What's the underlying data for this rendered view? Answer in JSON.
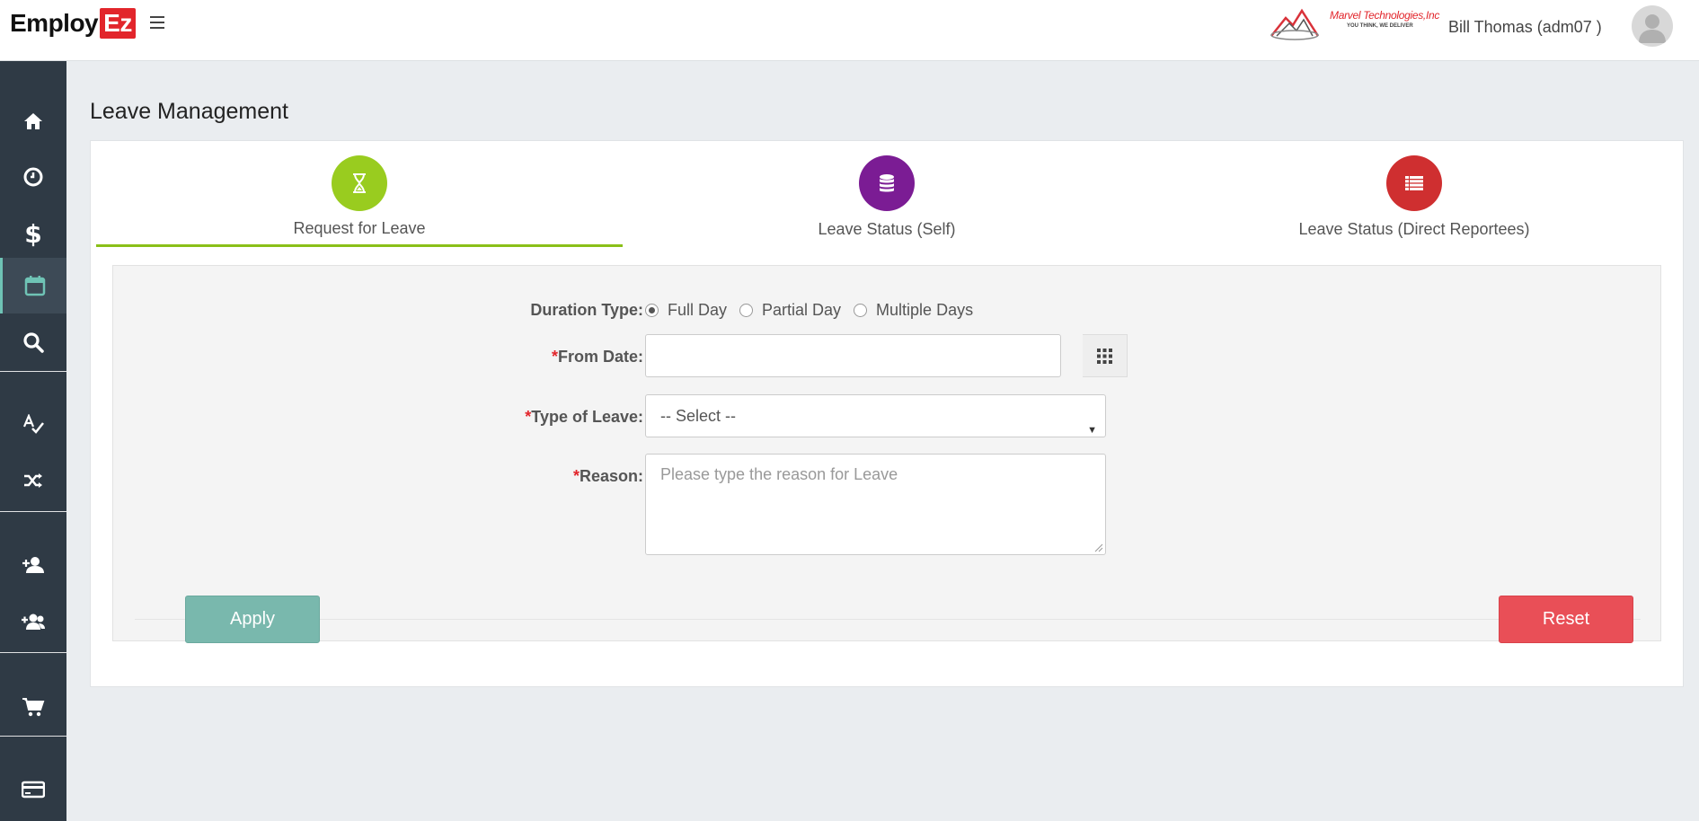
{
  "app": {
    "logo_prefix": "Employ",
    "logo_suffix": "Ez"
  },
  "header": {
    "company_name": "Marvel Technologies,Inc",
    "company_tagline": "YOU THINK, WE DELIVER",
    "user_display": "Bill Thomas (adm07 )"
  },
  "sidebar": {
    "items": [
      {
        "icon": "home-icon"
      },
      {
        "icon": "clock-icon"
      },
      {
        "icon": "dollar-icon"
      },
      {
        "icon": "calendar-icon",
        "active": true
      },
      {
        "icon": "search-icon"
      },
      {
        "icon": "spellcheck-icon"
      },
      {
        "icon": "shuffle-icon"
      },
      {
        "icon": "add-user-icon"
      },
      {
        "icon": "add-group-icon"
      },
      {
        "icon": "cart-icon"
      },
      {
        "icon": "credit-card-icon"
      }
    ]
  },
  "page": {
    "title": "Leave Management"
  },
  "tabs": [
    {
      "label": "Request for Leave",
      "icon": "hourglass-icon",
      "color": "#99cc1f",
      "active": true
    },
    {
      "label": "Leave Status (Self)",
      "icon": "database-icon",
      "color": "#7b1c94",
      "active": false
    },
    {
      "label": "Leave Status (Direct Reportees)",
      "icon": "list-icon",
      "color": "#cf2f30",
      "active": false
    }
  ],
  "form": {
    "duration_label": "Duration Type:",
    "duration_options": [
      "Full Day",
      "Partial Day",
      "Multiple Days"
    ],
    "duration_selected": "Full Day",
    "required_mark": "*",
    "from_date_label": "From Date:",
    "from_date_value": "",
    "leave_type_label": "Type of Leave:",
    "leave_type_selected": "-- Select --",
    "reason_label": "Reason:",
    "reason_placeholder": "Please type the reason for Leave",
    "apply_label": "Apply",
    "reset_label": "Reset"
  },
  "colors": {
    "sidebar_bg": "#2f3a45",
    "active_accent": "#6fc3b5",
    "apply": "#79b8ad",
    "reset": "#e94f57",
    "tab_underline": "#8ac018"
  }
}
